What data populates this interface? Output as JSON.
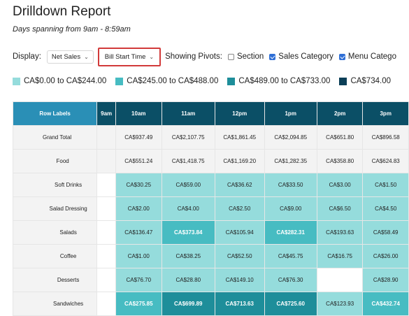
{
  "report": {
    "title": "Drilldown Report",
    "subtitle": "Days spanning from 9am - 8:59am"
  },
  "controls": {
    "display_label": "Display:",
    "display_value": "Net Sales",
    "pivot_value": "Bill Start Time",
    "pivots_label": "Showing Pivots:",
    "options": [
      {
        "label": "Section",
        "checked": false
      },
      {
        "label": "Sales Category",
        "checked": true
      },
      {
        "label": "Menu Catego",
        "checked": true
      }
    ]
  },
  "legend": [
    {
      "label": "CA$0.00 to CA$244.00",
      "color": "#95dcdc"
    },
    {
      "label": "CA$245.00 to CA$488.00",
      "color": "#47bcc2"
    },
    {
      "label": "CA$489.00 to CA$733.00",
      "color": "#1e8e9a"
    },
    {
      "label": "CA$734.00",
      "color": "#0b3f57"
    }
  ],
  "table": {
    "row_labels_header": "Row Labels",
    "hours": [
      "9am",
      "10am",
      "11am",
      "12pm",
      "1pm",
      "2pm",
      "3pm"
    ],
    "rows": [
      {
        "label": "Grand Total",
        "indent": 0,
        "cells": [
          "",
          "CA$937.49",
          "CA$2,107.75",
          "CA$1,861.45",
          "CA$2,094.85",
          "CA$651.80",
          "CA$896.58"
        ],
        "shade": [
          "cl",
          "cl",
          "cl",
          "cl",
          "cl",
          "cl",
          "cl"
        ]
      },
      {
        "label": "Food",
        "indent": 1,
        "cells": [
          "",
          "CA$551.24",
          "CA$1,418.75",
          "CA$1,169.20",
          "CA$1,282.35",
          "CA$358.80",
          "CA$624.83"
        ],
        "shade": [
          "cl",
          "cl",
          "cl",
          "cl",
          "cl",
          "cl",
          "cl"
        ]
      },
      {
        "label": "Soft Drinks",
        "indent": 2,
        "cells": [
          "",
          "CA$30.25",
          "CA$59.00",
          "CA$36.62",
          "CA$33.50",
          "CA$3.00",
          "CA$1.50"
        ],
        "shade": [
          "c0",
          "c1",
          "c1",
          "c1",
          "c1",
          "c1",
          "c1"
        ]
      },
      {
        "label": "Salad Dressing",
        "indent": 2,
        "cells": [
          "",
          "CA$2.00",
          "CA$4.00",
          "CA$2.50",
          "CA$9.00",
          "CA$6.50",
          "CA$4.50"
        ],
        "shade": [
          "c0",
          "c1",
          "c1",
          "c1",
          "c1",
          "c1",
          "c1"
        ]
      },
      {
        "label": "Salads",
        "indent": 2,
        "cells": [
          "",
          "CA$136.47",
          "CA$373.84",
          "CA$105.94",
          "CA$282.31",
          "CA$193.63",
          "CA$58.49"
        ],
        "shade": [
          "c0",
          "c1",
          "c2",
          "c1",
          "c2",
          "c1",
          "c1"
        ]
      },
      {
        "label": "Coffee",
        "indent": 2,
        "cells": [
          "",
          "CA$1.00",
          "CA$38.25",
          "CA$52.50",
          "CA$45.75",
          "CA$16.75",
          "CA$26.00"
        ],
        "shade": [
          "c0",
          "c1",
          "c1",
          "c1",
          "c1",
          "c1",
          "c1"
        ]
      },
      {
        "label": "Desserts",
        "indent": 2,
        "cells": [
          "",
          "CA$76.70",
          "CA$28.80",
          "CA$149.10",
          "CA$76.30",
          "",
          "CA$28.90"
        ],
        "shade": [
          "c0",
          "c1",
          "c1",
          "c1",
          "c1",
          "empty",
          "c1"
        ]
      },
      {
        "label": "Sandwiches",
        "indent": 2,
        "cells": [
          "",
          "CA$275.85",
          "CA$699.89",
          "CA$713.63",
          "CA$725.60",
          "CA$123.93",
          "CA$432.74"
        ],
        "shade": [
          "c0",
          "c2",
          "c3",
          "c3",
          "c3",
          "c1",
          "c2"
        ]
      }
    ]
  }
}
